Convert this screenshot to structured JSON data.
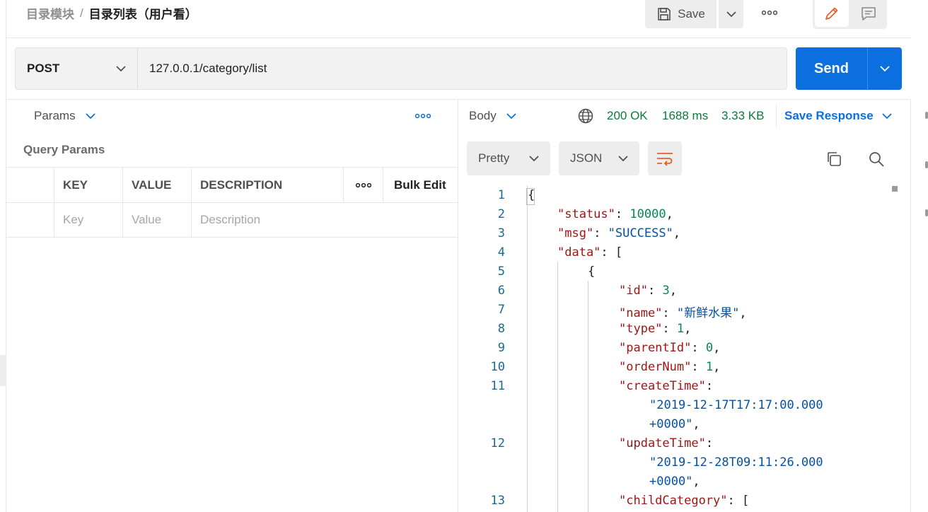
{
  "header": {
    "breadcrumb_parent": "目录模块",
    "breadcrumb_sep": "/",
    "breadcrumb_current": "目录列表（用户看）",
    "save_label": "Save"
  },
  "request": {
    "method": "POST",
    "url": "127.0.0.1/category/list",
    "send_label": "Send"
  },
  "left_pane": {
    "tab_label": "Params",
    "section_title": "Query Params",
    "columns": {
      "key": "KEY",
      "value": "VALUE",
      "description": "DESCRIPTION",
      "bulk_edit": "Bulk Edit"
    },
    "placeholders": {
      "key": "Key",
      "value": "Value",
      "description": "Description"
    }
  },
  "response": {
    "tab_label": "Body",
    "status": "200 OK",
    "time": "1688 ms",
    "size": "3.33 KB",
    "save_response": "Save Response",
    "view_mode": "Pretty",
    "format": "JSON"
  },
  "code_lines": [
    {
      "n": "1",
      "text": "{"
    },
    {
      "n": "2",
      "key": "\"status\"",
      "sep": ": ",
      "num": "10000",
      "tail": ","
    },
    {
      "n": "3",
      "key": "\"msg\"",
      "sep": ": ",
      "str": "\"SUCCESS\"",
      "tail": ","
    },
    {
      "n": "4",
      "key": "\"data\"",
      "sep": ": ",
      "tail": "["
    },
    {
      "n": "5",
      "text": "{"
    },
    {
      "n": "6",
      "key": "\"id\"",
      "sep": ": ",
      "num": "3",
      "tail": ","
    },
    {
      "n": "7",
      "key": "\"name\"",
      "sep": ": ",
      "str": "\"新鲜水果\"",
      "tail": ","
    },
    {
      "n": "8",
      "key": "\"type\"",
      "sep": ": ",
      "num": "1",
      "tail": ","
    },
    {
      "n": "9",
      "key": "\"parentId\"",
      "sep": ": ",
      "num": "0",
      "tail": ","
    },
    {
      "n": "10",
      "key": "\"orderNum\"",
      "sep": ": ",
      "num": "1",
      "tail": ","
    },
    {
      "n": "11",
      "key": "\"createTime\"",
      "sep": ":",
      "tail": ""
    },
    {
      "n": "",
      "str": "\"2019-12-17T17:17:00.000"
    },
    {
      "n": "",
      "str": "+0000\"",
      "tail": ","
    },
    {
      "n": "12",
      "key": "\"updateTime\"",
      "sep": ":",
      "tail": ""
    },
    {
      "n": "",
      "str": "\"2019-12-28T09:11:26.000"
    },
    {
      "n": "",
      "str": "+0000\"",
      "tail": ","
    },
    {
      "n": "13",
      "key": "\"childCategory\"",
      "sep": ": ",
      "tail": "["
    }
  ],
  "icons": {
    "save": "save-icon",
    "more": "more-horizontal-icon",
    "edit": "pencil-icon",
    "comment": "comment-icon",
    "globe": "globe-icon",
    "wrap": "wrap-lines-icon",
    "copy": "copy-icon",
    "search": "search-icon"
  },
  "colors": {
    "accent": "#0b6fe0",
    "success": "#0c7a3c",
    "edit_icon": "#e0602a"
  }
}
